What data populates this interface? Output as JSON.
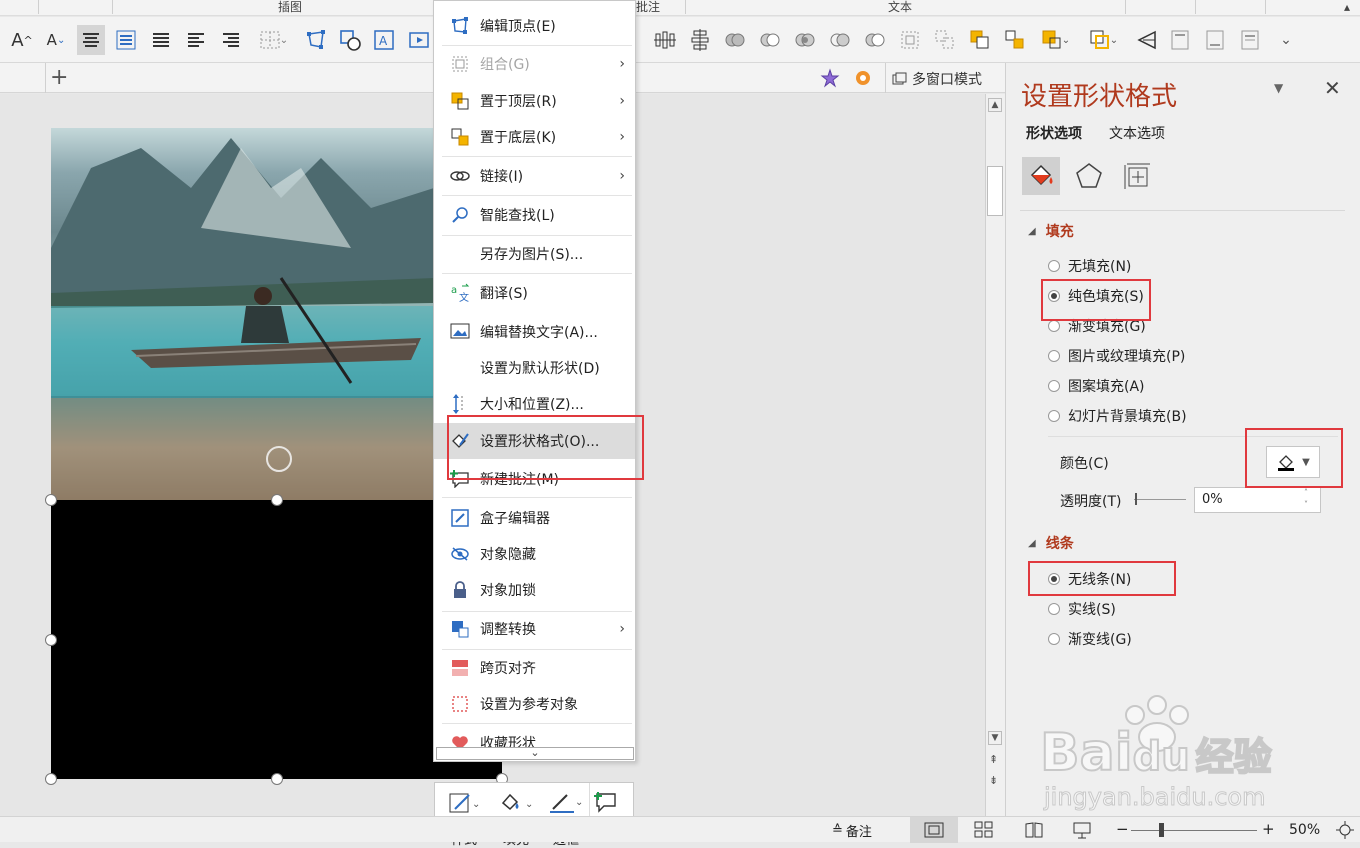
{
  "ribbon": {
    "group_labels": [
      "插图",
      "批注",
      "文本"
    ]
  },
  "tabbar": {
    "add_tab_label": "+",
    "multi_window_label": "多窗口模式"
  },
  "context_menu": {
    "items": [
      {
        "label": "编辑顶点(E)",
        "icon": "edit-points-icon",
        "disabled": false,
        "submenu": false
      },
      {
        "label": "组合(G)",
        "icon": "group-icon",
        "disabled": true,
        "submenu": true
      },
      {
        "label": "置于顶层(R)",
        "icon": "bring-to-front-icon",
        "disabled": false,
        "submenu": true
      },
      {
        "label": "置于底层(K)",
        "icon": "send-to-back-icon",
        "disabled": false,
        "submenu": true
      },
      {
        "label": "链接(I)",
        "icon": "link-icon",
        "disabled": false,
        "submenu": true
      },
      {
        "label": "智能查找(L)",
        "icon": "smart-lookup-icon",
        "disabled": false,
        "submenu": false
      },
      {
        "label": "另存为图片(S)...",
        "icon": "",
        "disabled": false,
        "submenu": false
      },
      {
        "label": "翻译(S)",
        "icon": "translate-icon",
        "disabled": false,
        "submenu": false
      },
      {
        "label": "编辑替换文字(A)...",
        "icon": "alt-text-icon",
        "disabled": false,
        "submenu": false
      },
      {
        "label": "设置为默认形状(D)",
        "icon": "",
        "disabled": false,
        "submenu": false
      },
      {
        "label": "大小和位置(Z)...",
        "icon": "size-position-icon",
        "disabled": false,
        "submenu": false
      },
      {
        "label": "设置形状格式(O)...",
        "icon": "format-shape-icon",
        "disabled": false,
        "submenu": false,
        "highlighted": true
      },
      {
        "label": "新建批注(M)",
        "icon": "new-comment-icon",
        "disabled": false,
        "submenu": false
      },
      {
        "label": "盒子编辑器",
        "icon": "box-editor-icon",
        "disabled": false,
        "submenu": false
      },
      {
        "label": "对象隐藏",
        "icon": "hide-object-icon",
        "disabled": false,
        "submenu": false
      },
      {
        "label": "对象加锁",
        "icon": "lock-icon",
        "disabled": false,
        "submenu": false
      },
      {
        "label": "调整转换",
        "icon": "adjust-convert-icon",
        "disabled": false,
        "submenu": true
      },
      {
        "label": "跨页对齐",
        "icon": "cross-page-align-icon",
        "disabled": false,
        "submenu": false
      },
      {
        "label": "设置为参考对象",
        "icon": "reference-object-icon",
        "disabled": false,
        "submenu": false
      },
      {
        "label": "收藏形状",
        "icon": "heart-icon",
        "disabled": false,
        "submenu": false
      }
    ],
    "scroll_more": "⌄"
  },
  "mini_toolbar": {
    "style_label": "样式",
    "fill_label": "填充",
    "border_label": "边框",
    "new_label": "新建"
  },
  "format_pane": {
    "title": "设置形状格式",
    "tabs": [
      "形状选项",
      "文本选项"
    ],
    "fill_section": "填充",
    "fill_options": [
      {
        "label": "无填充(N)",
        "checked": false
      },
      {
        "label": "纯色填充(S)",
        "checked": true
      },
      {
        "label": "渐变填充(G)",
        "checked": false
      },
      {
        "label": "图片或纹理填充(P)",
        "checked": false
      },
      {
        "label": "图案填充(A)",
        "checked": false
      },
      {
        "label": "幻灯片背景填充(B)",
        "checked": false
      }
    ],
    "color_label": "颜色(C)",
    "transparency_label": "透明度(T)",
    "transparency_value": "0%",
    "line_section": "线条",
    "line_options": [
      {
        "label": "无线条(N)",
        "checked": true
      },
      {
        "label": "实线(S)",
        "checked": false
      },
      {
        "label": "渐变线(G)",
        "checked": false
      }
    ]
  },
  "status_bar": {
    "notes_label": "备注",
    "zoom_minus": "−",
    "zoom_plus": "+",
    "zoom_level": "50%"
  },
  "watermark": {
    "brand": "Bai",
    "brand2": "du",
    "brand_cn": "经验",
    "url": "jingyan.baidu.com"
  },
  "colors": {
    "accent_red": "#b03a1e",
    "annotation_red": "#e0393e",
    "icon_blue": "#2e6dc2"
  }
}
